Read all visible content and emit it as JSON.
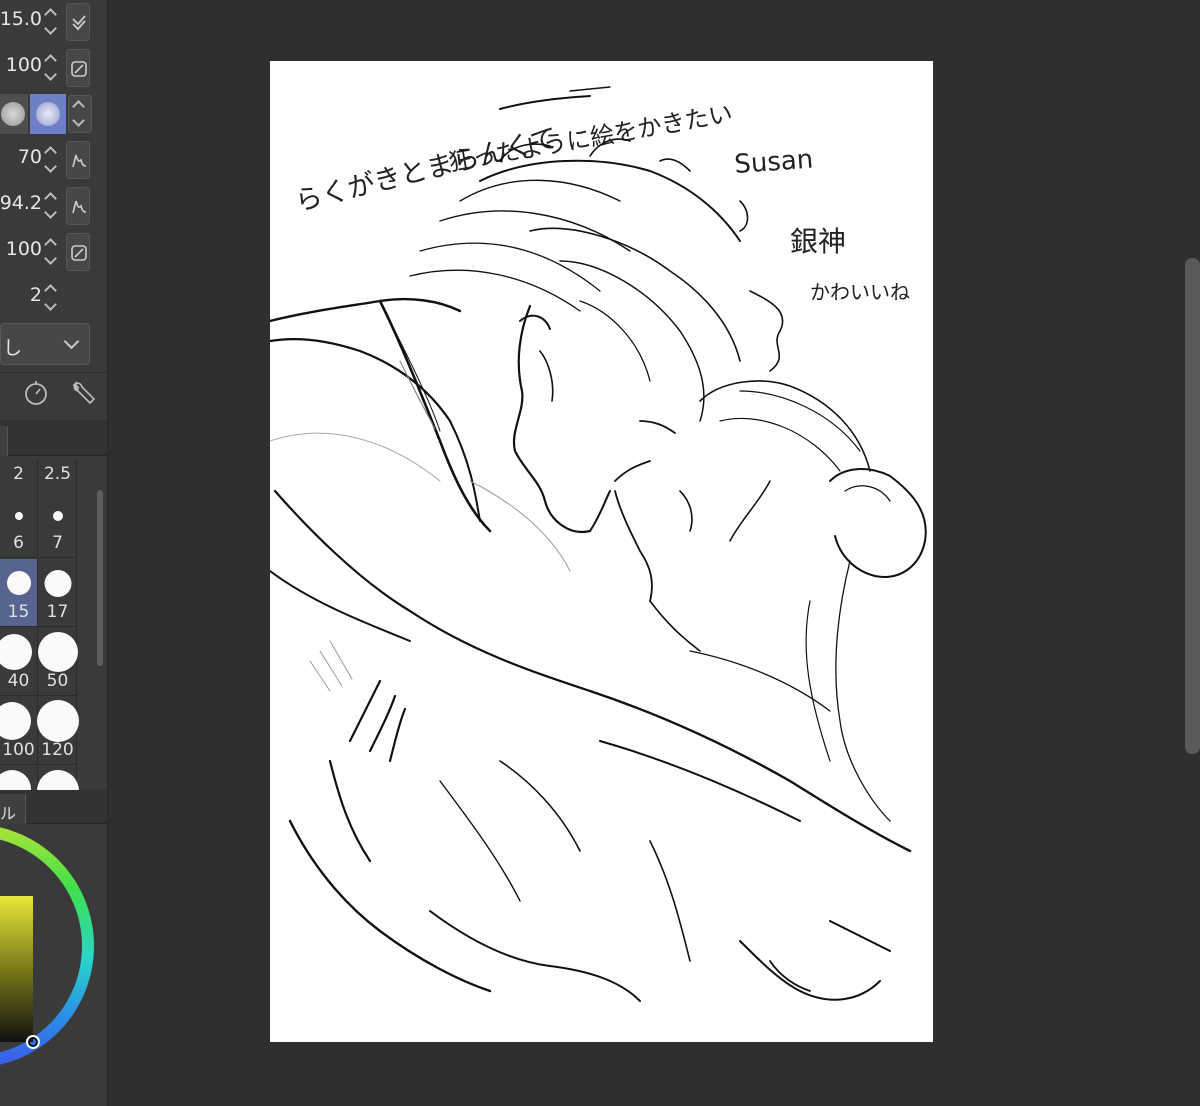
{
  "tool_property": {
    "rows": [
      {
        "value": "15.0"
      },
      {
        "value": "100"
      },
      {
        "value": ""
      },
      {
        "value": "70"
      },
      {
        "value": "94.2"
      },
      {
        "value": "100"
      },
      {
        "value": "2"
      }
    ],
    "select_value": "し"
  },
  "brush_sizes": [
    "2",
    "2.5",
    "6",
    "7",
    "15",
    "17",
    "40",
    "50",
    "100",
    "120"
  ],
  "selected_brush_size": "15",
  "color_panel": {
    "tab_label": "ル"
  },
  "canvas": {
    "annotations": {
      "line1": "らくがきとまらんくて",
      "line2": "狂ったように絵をかきたい",
      "name": "Susan",
      "title": "銀神",
      "caption": "かわいいね"
    }
  },
  "colors": {
    "panel": "#3a3a3a",
    "accent": "#56648f",
    "workspace": "#2f2f2f"
  }
}
